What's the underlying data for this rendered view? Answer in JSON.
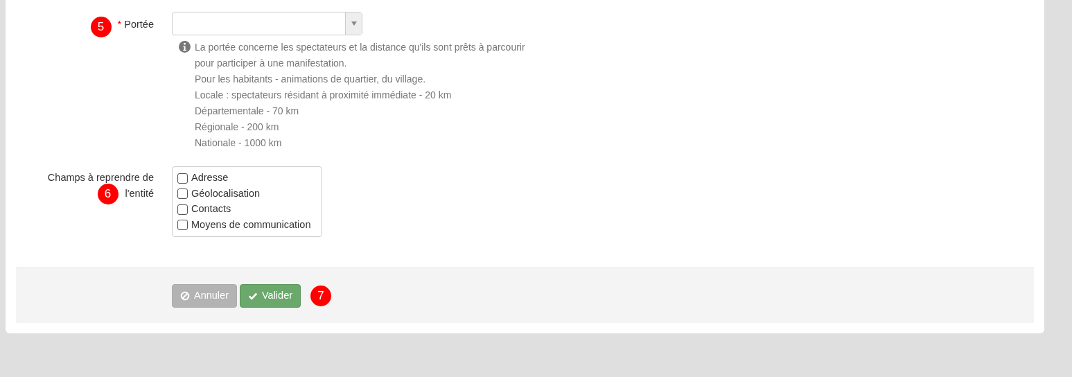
{
  "fields": [
    {
      "kind": "select",
      "badge": "5",
      "required_mark": "*",
      "label": "Portée",
      "help": [
        "La portée concerne les spectateurs et la distance qu'ils sont prêts à parcourir pour participer à une manifestation.",
        "Pour les habitants - animations de quartier, du village.",
        "Locale : spectateurs résidant à proximité immédiate - 20 km",
        "Départementale - 70 km",
        "Régionale - 200 km",
        "Nationale - 1000 km"
      ]
    },
    {
      "kind": "checklist",
      "badge": "6",
      "label_lines": [
        "Champs à reprendre de",
        "l'entité"
      ],
      "options": [
        {
          "label": "Adresse",
          "checked": false
        },
        {
          "label": "Géolocalisation",
          "checked": false
        },
        {
          "label": "Contacts",
          "checked": false
        },
        {
          "label": "Moyens de communication",
          "checked": false
        }
      ]
    }
  ],
  "footer": {
    "buttons": [
      {
        "kind": "cancel",
        "label": "Annuler",
        "disabled": true
      },
      {
        "kind": "submit",
        "label": "Valider",
        "disabled": false
      }
    ],
    "badge": "7"
  }
}
